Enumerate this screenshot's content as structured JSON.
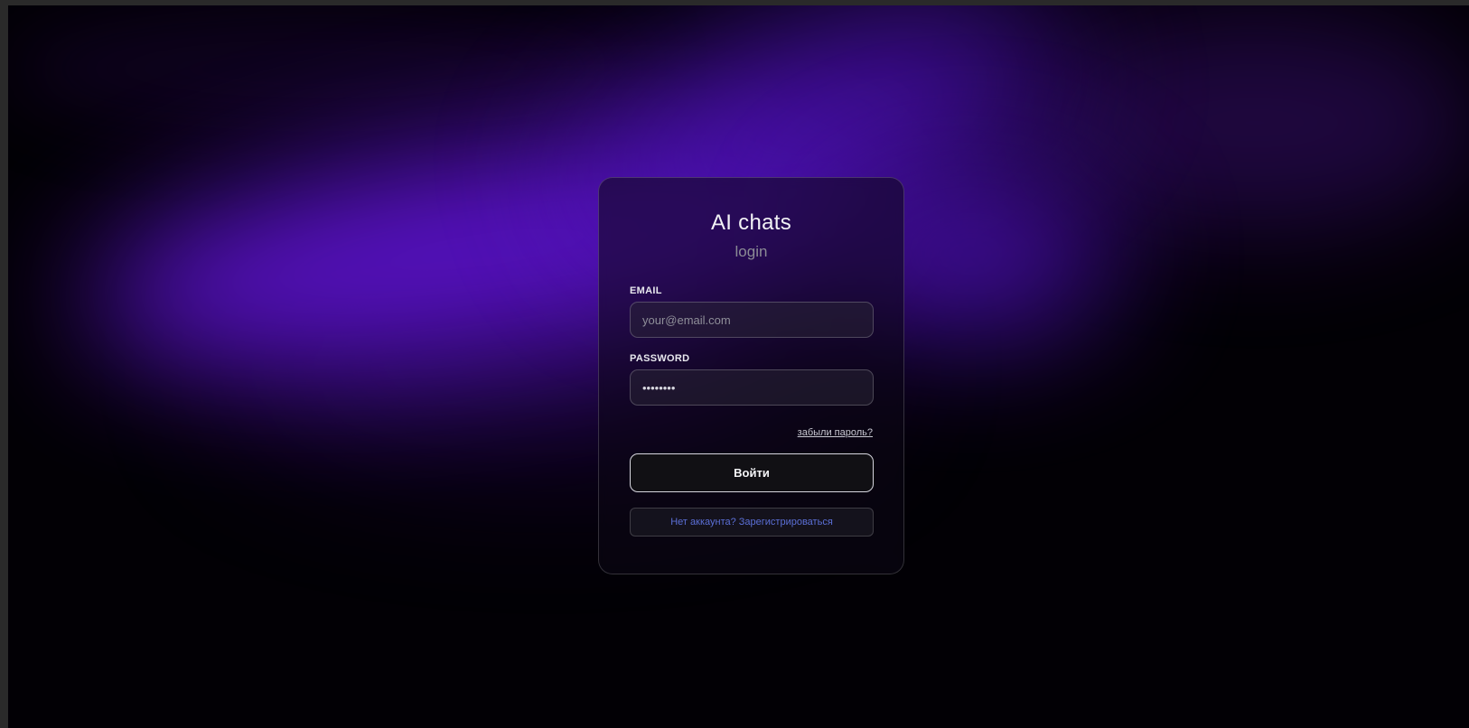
{
  "card": {
    "title": "AI chats",
    "subtitle": "login"
  },
  "email": {
    "label": "EMAIL",
    "placeholder": "your@email.com",
    "value": ""
  },
  "password": {
    "label": "PASSWORD",
    "value": "••••••••"
  },
  "forgot_link": "забыли пароль?",
  "login_button": "Войти",
  "register_button": "Нет аккаунта? Зарегистрироваться",
  "colors": {
    "background": "#020005",
    "glow": "#5a12c8",
    "register_link": "#5b6fd6"
  }
}
